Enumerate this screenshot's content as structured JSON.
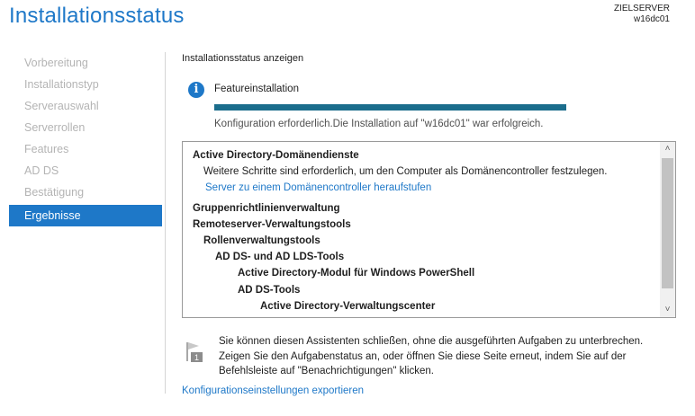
{
  "window": {
    "title": "Installationsstatus",
    "target_server_label": "ZIELSERVER",
    "target_server_name": "w16dc01"
  },
  "nav": {
    "items": [
      {
        "label": "Vorbereitung",
        "active": false
      },
      {
        "label": "Installationstyp",
        "active": false
      },
      {
        "label": "Serverauswahl",
        "active": false
      },
      {
        "label": "Serverrollen",
        "active": false
      },
      {
        "label": "Features",
        "active": false
      },
      {
        "label": "AD DS",
        "active": false
      },
      {
        "label": "Bestätigung",
        "active": false
      },
      {
        "label": "Ergebnisse",
        "active": true
      }
    ]
  },
  "main": {
    "section_title": "Installationsstatus anzeigen",
    "feature_label": "Featureinstallation",
    "progress_percent": 100,
    "status_text": "Konfiguration erforderlich.Die Installation auf \"w16dc01\" war erfolgreich.",
    "results": [
      {
        "text": "Active Directory-Domänendienste",
        "style": "bold",
        "indent": 0
      },
      {
        "text": "Weitere Schritte sind erforderlich, um den Computer als Domänencontroller festzulegen.",
        "style": "normal",
        "indent": 1
      },
      {
        "text": "Server zu einem Domänencontroller heraufstufen",
        "style": "link",
        "indent": 1
      },
      {
        "text": "Gruppenrichtlinienverwaltung",
        "style": "bold",
        "indent": 0
      },
      {
        "text": "Remoteserver-Verwaltungstools",
        "style": "bold",
        "indent": 0
      },
      {
        "text": "Rollenverwaltungstools",
        "style": "bold",
        "indent": 1
      },
      {
        "text": "AD DS- und AD LDS-Tools",
        "style": "bold",
        "indent": 2
      },
      {
        "text": "Active Directory-Modul für Windows PowerShell",
        "style": "bold",
        "indent": 3
      },
      {
        "text": "AD DS-Tools",
        "style": "bold",
        "indent": 3
      },
      {
        "text": "Active Directory-Verwaltungscenter",
        "style": "bold",
        "indent": 4
      }
    ],
    "note": "Sie können diesen Assistenten schließen, ohne die ausgeführten Aufgaben zu unterbrechen. Zeigen Sie den Aufgabenstatus an, oder öffnen Sie diese Seite erneut, indem Sie auf der Befehlsleiste auf \"Benachrichtigungen\" klicken.",
    "notification_count": "1",
    "export_link": "Konfigurationseinstellungen exportieren"
  },
  "colors": {
    "accent": "#1e78c8",
    "progress": "#1b6d8c",
    "nav_inactive": "#b4b4b4"
  },
  "icons": {
    "info": "info-icon",
    "flag": "notification-flag-icon",
    "scroll_up": "chevron-up-icon",
    "scroll_down": "chevron-down-icon"
  }
}
